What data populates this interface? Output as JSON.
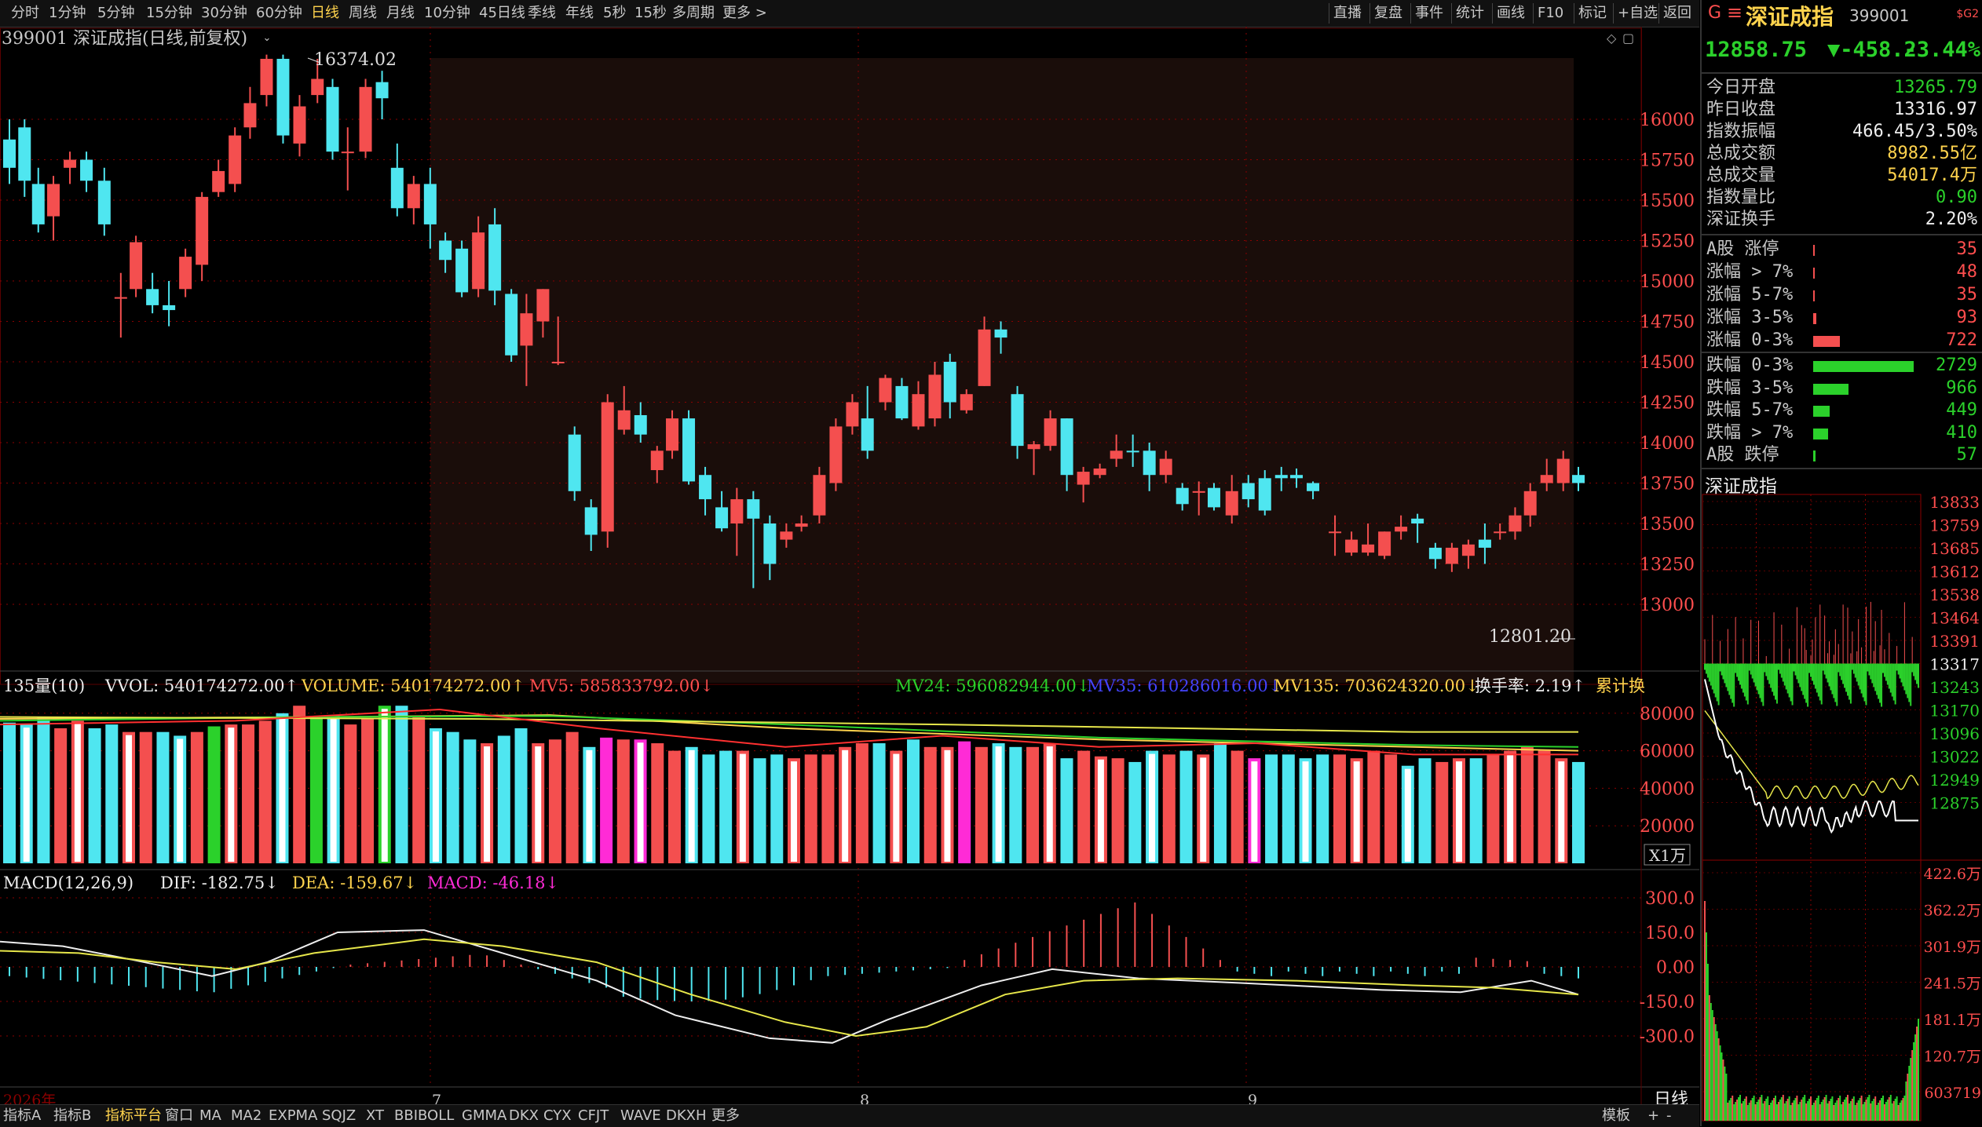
{
  "toolbar": {
    "periods": [
      "分时",
      "1分钟",
      "5分钟",
      "15分钟",
      "30分钟",
      "60分钟",
      "日线",
      "周线",
      "月线",
      "10分钟",
      "45日线",
      "季线",
      "年线",
      "5秒",
      "15秒",
      "多周期",
      "更多 >"
    ],
    "active_period": "日线",
    "right_tools": [
      "直播",
      "复盘",
      "事件",
      "统计",
      "画线",
      "F10",
      "标记",
      "+自选",
      "返回"
    ]
  },
  "chart_header": {
    "title": "399001  深证成指(日线,前复权)",
    "high_label": "16374.02",
    "low_label": "12801.20"
  },
  "price_axis": [
    "16000",
    "15750",
    "15500",
    "15250",
    "15000",
    "14750",
    "14500",
    "14250",
    "14000",
    "13750",
    "13500",
    "13250",
    "13000"
  ],
  "volume_header": {
    "name": "135量(10)",
    "vvol": "VVOL: 540174272.00↑",
    "volume": "VOLUME: 540174272.00↑",
    "mv5": "MV5: 585833792.00↓",
    "mv24": "MV24: 596082944.00↓",
    "mv35": "MV35: 610286016.00↓",
    "mv135": "MV135: 703624320.00↓",
    "turnover": "换手率: 2.19↑",
    "cum": "累计换"
  },
  "volume_axis": [
    "80000",
    "60000",
    "40000",
    "20000"
  ],
  "volume_unit": "X1万",
  "macd_header": {
    "name": "MACD(12,26,9)",
    "dif": "DIF: -182.75↓",
    "dea": "DEA: -159.67↓",
    "macd": "MACD: -46.18↓"
  },
  "macd_axis": [
    "300.0",
    "150.0",
    "0.00",
    "-150.0",
    "-300.0"
  ],
  "time_axis": {
    "year": "2026年",
    "m7": "7",
    "m8": "8",
    "m9": "9"
  },
  "period_label": "日线",
  "bottom_tabs": [
    "指标A",
    "指标B",
    "指标平台",
    "窗口",
    "MA",
    "MA2",
    "EXPMA",
    "SQJZ",
    "XT",
    "BBIBOLL",
    "GMMA",
    "DKX",
    "CYX",
    "CFJT",
    "WAVE",
    "DKXH",
    "更多"
  ],
  "bottom_right": [
    "模板",
    "+",
    "-"
  ],
  "sidebar": {
    "g": "G",
    "menu": "≡",
    "name": "深证成指",
    "code": "399001",
    "corner": "$G2",
    "price": "12858.75",
    "change": "▼-458.2",
    "pct": "-3.44%",
    "stats": [
      {
        "k": "今日开盘",
        "v": "13265.79",
        "c": "green"
      },
      {
        "k": "昨日收盘",
        "v": "13316.97",
        "c": "white"
      },
      {
        "k": "指数振幅",
        "v": "466.45/3.50%",
        "c": "white"
      },
      {
        "k": "总成交额",
        "v": "8982.55亿",
        "c": "yellow"
      },
      {
        "k": "总成交量",
        "v": "54017.4万",
        "c": "yellow"
      },
      {
        "k": "指数量比",
        "v": "0.90",
        "c": "green"
      },
      {
        "k": "深证换手",
        "v": "2.20%",
        "c": "white"
      }
    ],
    "breadth_up": [
      {
        "k": "A股 涨停",
        "v": "35",
        "n": 35
      },
      {
        "k": "涨幅 > 7%",
        "v": "48",
        "n": 48
      },
      {
        "k": "涨幅 5-7%",
        "v": "35",
        "n": 35
      },
      {
        "k": "涨幅 3-5%",
        "v": "93",
        "n": 93
      },
      {
        "k": "涨幅 0-3%",
        "v": "722",
        "n": 722
      }
    ],
    "breadth_down": [
      {
        "k": "跌幅 0-3%",
        "v": "2729",
        "n": 2729
      },
      {
        "k": "跌幅 3-5%",
        "v": "966",
        "n": 966
      },
      {
        "k": "跌幅 5-7%",
        "v": "449",
        "n": 449
      },
      {
        "k": "跌幅 > 7%",
        "v": "410",
        "n": 410
      },
      {
        "k": "A股 跌停",
        "v": "57",
        "n": 57
      }
    ],
    "mini_title": "深证成指",
    "mini_axis": [
      "13833",
      "13759",
      "13685",
      "13612",
      "13538",
      "13464",
      "13391",
      "13317",
      "13243",
      "13170",
      "13096",
      "13022",
      "12949",
      "12875"
    ],
    "mini_vol_axis": [
      "422.6万",
      "362.2万",
      "301.9万",
      "241.5万",
      "181.1万",
      "120.7万",
      "603719"
    ]
  },
  "colors": {
    "up": "#f44f4f",
    "down": "#4fe6f0",
    "grid": "#8b0000",
    "mv5": "#ffffff",
    "mv24": "#ffd34d",
    "mv35": "#2bd12b",
    "mv135": "#ff3030"
  }
}
